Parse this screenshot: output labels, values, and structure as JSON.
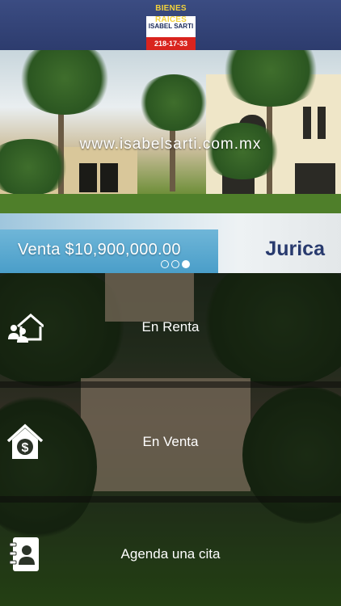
{
  "header": {
    "logo": {
      "line1": "BIENES RAICES",
      "line2": "ISABEL SARTI",
      "line3": "218-17-33"
    }
  },
  "hero": {
    "url": "www.isabelsarti.com.mx"
  },
  "listing": {
    "price": "Venta $10,900,000.00",
    "city": "Jurica",
    "carousel": {
      "total": 3,
      "active_index": 2
    }
  },
  "menu": [
    {
      "label": "En Renta",
      "icon": "home-people-icon"
    },
    {
      "label": "En Venta",
      "icon": "house-dollar-icon"
    },
    {
      "label": "Agenda una cita",
      "icon": "contact-book-icon"
    }
  ],
  "colors": {
    "header_bg": "#34467a",
    "logo_yellow": "#f2d23a",
    "logo_red": "#d9241e",
    "city_text": "#283a6e"
  }
}
